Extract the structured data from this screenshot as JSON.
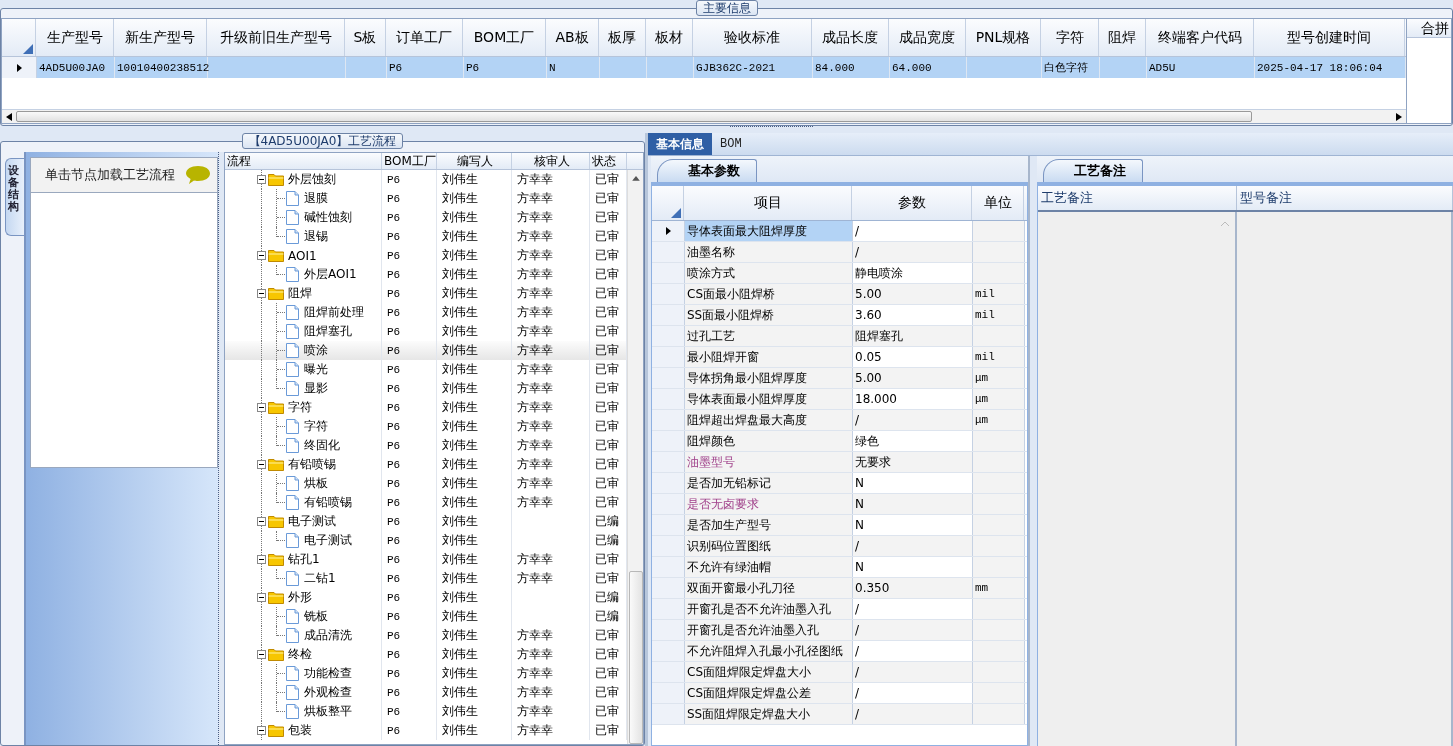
{
  "main_info": {
    "title": "主要信息",
    "columns": [
      "生产型号",
      "新生产型号",
      "升级前旧生产型号",
      "S板",
      "订单工厂",
      "BOM工厂",
      "AB板",
      "板厚",
      "板材",
      "验收标准",
      "成品长度",
      "成品宽度",
      "PNL规格",
      "字符",
      "阻焊",
      "终端客户代码",
      "型号创建时间"
    ],
    "rows": [
      {
        "selected": true,
        "cells": [
          "4AD5U00JA0",
          "10010400238512",
          null,
          null,
          "P6",
          "P6",
          "N",
          null,
          null,
          "GJB362C-2021",
          "84.000",
          "64.000",
          null,
          "白色字符",
          null,
          "AD5U",
          "2025-04-17 18:06:04"
        ]
      }
    ],
    "side_panel_title": "合拼"
  },
  "process_flow": {
    "title": "【4AD5U00JA0】工艺流程",
    "side_tab": "设备结构",
    "hint": "单击节点加载工艺流程",
    "columns": [
      "流程",
      "BOM工厂",
      "编写人",
      "核审人",
      "状态"
    ],
    "tree": [
      {
        "label": "外层蚀刻",
        "bom": "P6",
        "author": "刘伟生",
        "reviewer": "方幸幸",
        "status": "已审",
        "expanded": true,
        "selected": false,
        "children": [
          {
            "label": "退膜",
            "bom": "P6",
            "author": "刘伟生",
            "reviewer": "方幸幸",
            "status": "已审",
            "selected": false
          },
          {
            "label": "碱性蚀刻",
            "bom": "P6",
            "author": "刘伟生",
            "reviewer": "方幸幸",
            "status": "已审",
            "selected": false
          },
          {
            "label": "退锡",
            "bom": "P6",
            "author": "刘伟生",
            "reviewer": "方幸幸",
            "status": "已审",
            "selected": false
          }
        ]
      },
      {
        "label": "AOI1",
        "bom": "P6",
        "author": "刘伟生",
        "reviewer": "方幸幸",
        "status": "已审",
        "expanded": true,
        "selected": false,
        "children": [
          {
            "label": "外层AOI1",
            "bom": "P6",
            "author": "刘伟生",
            "reviewer": "方幸幸",
            "status": "已审",
            "selected": false
          }
        ]
      },
      {
        "label": "阻焊",
        "bom": "P6",
        "author": "刘伟生",
        "reviewer": "方幸幸",
        "status": "已审",
        "expanded": true,
        "selected": false,
        "children": [
          {
            "label": "阻焊前处理",
            "bom": "P6",
            "author": "刘伟生",
            "reviewer": "方幸幸",
            "status": "已审",
            "selected": false
          },
          {
            "label": "阻焊塞孔",
            "bom": "P6",
            "author": "刘伟生",
            "reviewer": "方幸幸",
            "status": "已审",
            "selected": false
          },
          {
            "label": "喷涂",
            "bom": "P6",
            "author": "刘伟生",
            "reviewer": "方幸幸",
            "status": "已审",
            "selected": true
          },
          {
            "label": "曝光",
            "bom": "P6",
            "author": "刘伟生",
            "reviewer": "方幸幸",
            "status": "已审",
            "selected": false
          },
          {
            "label": "显影",
            "bom": "P6",
            "author": "刘伟生",
            "reviewer": "方幸幸",
            "status": "已审",
            "selected": false
          }
        ]
      },
      {
        "label": "字符",
        "bom": "P6",
        "author": "刘伟生",
        "reviewer": "方幸幸",
        "status": "已审",
        "expanded": true,
        "selected": false,
        "children": [
          {
            "label": "字符",
            "bom": "P6",
            "author": "刘伟生",
            "reviewer": "方幸幸",
            "status": "已审",
            "selected": false
          },
          {
            "label": "终固化",
            "bom": "P6",
            "author": "刘伟生",
            "reviewer": "方幸幸",
            "status": "已审",
            "selected": false
          }
        ]
      },
      {
        "label": "有铅喷锡",
        "bom": "P6",
        "author": "刘伟生",
        "reviewer": "方幸幸",
        "status": "已审",
        "expanded": true,
        "selected": false,
        "children": [
          {
            "label": "烘板",
            "bom": "P6",
            "author": "刘伟生",
            "reviewer": "方幸幸",
            "status": "已审",
            "selected": false
          },
          {
            "label": "有铅喷锡",
            "bom": "P6",
            "author": "刘伟生",
            "reviewer": "方幸幸",
            "status": "已审",
            "selected": false
          }
        ]
      },
      {
        "label": "电子测试",
        "bom": "P6",
        "author": "刘伟生",
        "status": "已编",
        "expanded": true,
        "selected": false,
        "children": [
          {
            "label": "电子测试",
            "bom": "P6",
            "author": "刘伟生",
            "status": "已编",
            "selected": false
          }
        ]
      },
      {
        "label": "钻孔1",
        "bom": "P6",
        "author": "刘伟生",
        "reviewer": "方幸幸",
        "status": "已审",
        "expanded": true,
        "selected": false,
        "children": [
          {
            "label": "二钻1",
            "bom": "P6",
            "author": "刘伟生",
            "reviewer": "方幸幸",
            "status": "已审",
            "selected": false
          }
        ]
      },
      {
        "label": "外形",
        "bom": "P6",
        "author": "刘伟生",
        "status": "已编",
        "expanded": true,
        "selected": false,
        "children": [
          {
            "label": "铣板",
            "bom": "P6",
            "author": "刘伟生",
            "status": "已编",
            "selected": false
          },
          {
            "label": "成品清洗",
            "bom": "P6",
            "author": "刘伟生",
            "reviewer": "方幸幸",
            "status": "已审",
            "selected": false
          }
        ]
      },
      {
        "label": "终检",
        "bom": "P6",
        "author": "刘伟生",
        "reviewer": "方幸幸",
        "status": "已审",
        "expanded": true,
        "selected": false,
        "children": [
          {
            "label": "功能检查",
            "bom": "P6",
            "author": "刘伟生",
            "reviewer": "方幸幸",
            "status": "已审",
            "selected": false
          },
          {
            "label": "外观检查",
            "bom": "P6",
            "author": "刘伟生",
            "reviewer": "方幸幸",
            "status": "已审",
            "selected": false
          },
          {
            "label": "烘板整平",
            "bom": "P6",
            "author": "刘伟生",
            "reviewer": "方幸幸",
            "status": "已审",
            "selected": false
          }
        ]
      },
      {
        "label": "包装",
        "bom": "P6",
        "author": "刘伟生",
        "reviewer": "方幸幸",
        "status": "已审",
        "expanded": true,
        "selected": false
      }
    ]
  },
  "detail": {
    "tabs": [
      {
        "label": "基本信息",
        "selected": true
      },
      {
        "label": "BOM",
        "selected": false
      }
    ],
    "params": {
      "tab": "基本参数",
      "columns": [
        "项目",
        "参数",
        "单位"
      ],
      "rows": [
        {
          "item": "导体表面最大阻焊厚度",
          "value": "/",
          "selected": true,
          "emphasized": false
        },
        {
          "item": "油墨名称",
          "value": "/",
          "selected": false,
          "emphasized": false
        },
        {
          "item": "喷涂方式",
          "value": "静电喷涂",
          "selected": false,
          "emphasized": false
        },
        {
          "item": "CS面最小阻焊桥",
          "value": "5.00",
          "unit": "mil",
          "selected": false,
          "emphasized": false
        },
        {
          "item": "SS面最小阻焊桥",
          "value": "3.60",
          "unit": "mil",
          "selected": false,
          "emphasized": false
        },
        {
          "item": "过孔工艺",
          "value": "阻焊塞孔",
          "selected": false,
          "emphasized": false
        },
        {
          "item": "最小阻焊开窗",
          "value": "0.05",
          "unit": "mil",
          "selected": false,
          "emphasized": false
        },
        {
          "item": "导体拐角最小阻焊厚度",
          "value": "5.00",
          "unit": "μm",
          "selected": false,
          "emphasized": false
        },
        {
          "item": "导体表面最小阻焊厚度",
          "value": "18.000",
          "unit": "μm",
          "selected": false,
          "emphasized": false
        },
        {
          "item": "阻焊超出焊盘最大高度",
          "value": "/",
          "unit": "μm",
          "selected": false,
          "emphasized": false
        },
        {
          "item": "阻焊颜色",
          "value": "绿色",
          "selected": false,
          "emphasized": false
        },
        {
          "item": "油墨型号",
          "value": "无要求",
          "selected": false,
          "emphasized": true
        },
        {
          "item": "是否加无铅标记",
          "value": "N",
          "selected": false,
          "emphasized": false
        },
        {
          "item": "是否无卤要求",
          "value": "N",
          "selected": false,
          "emphasized": true
        },
        {
          "item": "是否加生产型号",
          "value": "N",
          "selected": false,
          "emphasized": false
        },
        {
          "item": "识别码位置图纸",
          "value": "/",
          "selected": false,
          "emphasized": false
        },
        {
          "item": "不允许有绿油帽",
          "value": "N",
          "selected": false,
          "emphasized": false
        },
        {
          "item": "双面开窗最小孔刀径",
          "value": "0.350",
          "unit": "mm",
          "selected": false,
          "emphasized": false
        },
        {
          "item": "开窗孔是否不允许油墨入孔",
          "value": "/",
          "selected": false,
          "emphasized": false
        },
        {
          "item": "开窗孔是否允许油墨入孔",
          "value": "/",
          "selected": false,
          "emphasized": false
        },
        {
          "item": "不允许阻焊入孔最小孔径图纸",
          "value": "/",
          "selected": false,
          "emphasized": false
        },
        {
          "item": "CS面阻焊限定焊盘大小",
          "value": "/",
          "selected": false,
          "emphasized": false
        },
        {
          "item": "CS面阻焊限定焊盘公差",
          "value": "/",
          "selected": false,
          "emphasized": false
        },
        {
          "item": "SS面阻焊限定焊盘大小",
          "value": "/",
          "selected": false,
          "emphasized": false
        }
      ]
    },
    "notes": {
      "tab": "工艺备注",
      "columns": [
        "工艺备注",
        "型号备注"
      ]
    }
  }
}
